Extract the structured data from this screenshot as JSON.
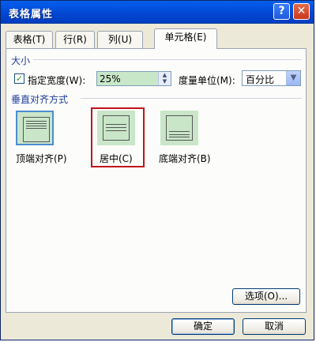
{
  "window": {
    "title": "表格属性",
    "help": "?",
    "close": "✕"
  },
  "tabs": [
    {
      "label": "表格(T)"
    },
    {
      "label": "行(R)"
    },
    {
      "label": "列(U)"
    },
    {
      "label": "单元格(E)",
      "active": true
    }
  ],
  "size_group": {
    "title": "大小",
    "checkbox_checked": true,
    "specify_width_label": "指定宽度(W):",
    "width_value": "25%",
    "unit_label": "度量单位(M):",
    "unit_value": "百分比"
  },
  "valign_group": {
    "title": "垂直对齐方式",
    "options": [
      {
        "label": "顶端对齐(P)"
      },
      {
        "label": "居中(C)"
      },
      {
        "label": "底端对齐(B)"
      }
    ]
  },
  "buttons": {
    "options": "选项(O)...",
    "ok": "确定",
    "cancel": "取消"
  },
  "colors": {
    "accent": "#0058e6",
    "highlight_box": "#c0151b",
    "option_bg": "#c9e6c9"
  }
}
